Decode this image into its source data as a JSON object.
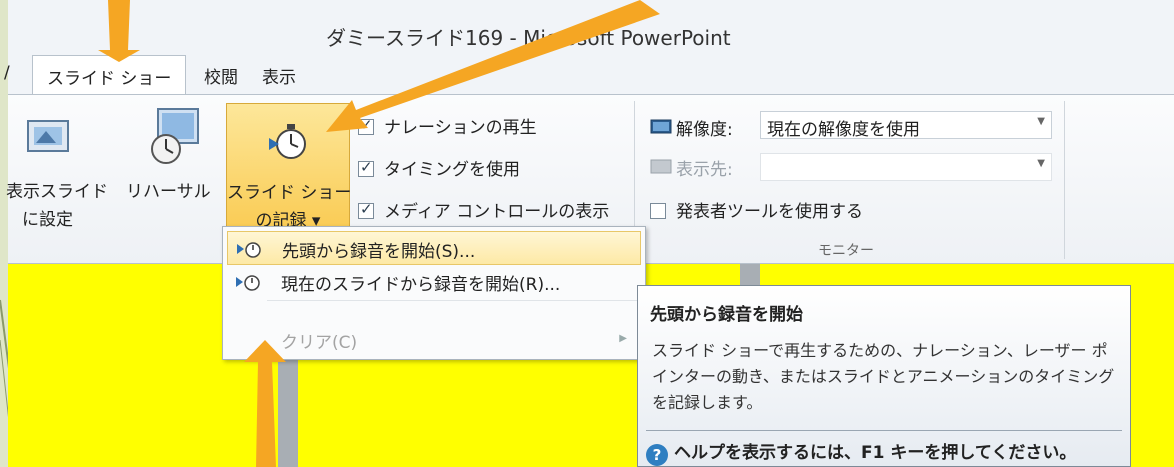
{
  "window": {
    "title": "ダミースライド169 - Microsoft PowerPoint"
  },
  "tabs": [
    {
      "label": "スライド ショー",
      "active": true
    },
    {
      "label": "校閲",
      "active": false
    },
    {
      "label": "表示",
      "active": false
    }
  ],
  "ribbon": {
    "set_slide_label_1": "表示スライド",
    "set_slide_label_2": "に設定",
    "rehearsal_label": "リハーサル",
    "record_label_1": "スライド ショー",
    "record_label_2": "の記録 ▾",
    "checkboxes": [
      {
        "label": "ナレーションの再生",
        "checked": true
      },
      {
        "label": "タイミングを使用",
        "checked": true
      },
      {
        "label": "メディア コントロールの表示",
        "checked": true
      }
    ],
    "resolution_label": "解像度:",
    "resolution_value": "現在の解像度を使用",
    "display_on_label": "表示先:",
    "display_on_value": "",
    "presenter_view_label": "発表者ツールを使用する",
    "presenter_view_checked": false,
    "monitor_group_label": "モニター"
  },
  "menu": {
    "items": [
      {
        "label": "先頭から録音を開始(S)...",
        "state": "hover"
      },
      {
        "label": "現在のスライドから録音を開始(R)...",
        "state": "normal"
      },
      {
        "label": "クリア(C)",
        "state": "disabled",
        "submenu": true
      }
    ]
  },
  "tooltip": {
    "title": "先頭から録音を開始",
    "body": "スライド ショーで再生するための、ナレーション、レーザー ポインターの動き、またはスライドとアニメーションのタイミングを記録します。",
    "help": "ヘルプを表示するには、F1 キーを押してください。"
  },
  "colors": {
    "slide_bg": "#ffff00",
    "arrow": "#f5a623",
    "record_highlight": "#f9c94e"
  }
}
